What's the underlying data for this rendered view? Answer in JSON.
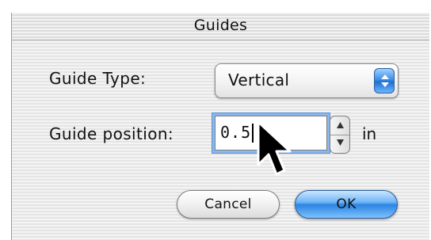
{
  "window": {
    "title": "Guides"
  },
  "form": {
    "guide_type_label": "Guide Type:",
    "guide_type_value": "Vertical",
    "guide_position_label": "Guide position:",
    "guide_position_value": "0.5",
    "guide_position_unit": "in"
  },
  "buttons": {
    "cancel_label": "Cancel",
    "ok_label": "OK"
  },
  "icons": {
    "popup_arrows": "popup-up-down-arrows-icon",
    "stepper_up": "stepper-up-arrow-icon",
    "stepper_down": "stepper-down-arrow-icon",
    "cursor": "mouse-pointer-icon"
  },
  "colors": {
    "accent_blue": "#2c84e3",
    "focus_ring": "#8ab8ee"
  }
}
